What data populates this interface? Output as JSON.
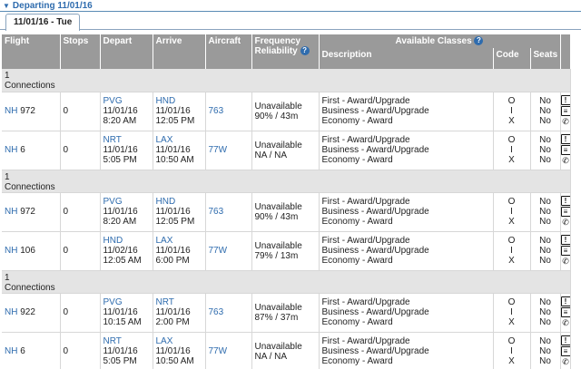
{
  "section": {
    "title": "Departing 11/01/16"
  },
  "tab": {
    "label": "11/01/16 - Tue"
  },
  "headers": {
    "flight": "Flight",
    "stops": "Stops",
    "depart": "Depart",
    "arrive": "Arrive",
    "aircraft": "Aircraft",
    "frequency": "Frequency",
    "reliability": "Reliability",
    "available_classes": "Available Classes",
    "description": "Description",
    "code": "Code",
    "seats": "Seats"
  },
  "connections_label": [
    "1",
    "Connections"
  ],
  "groups": [
    {
      "legs": [
        {
          "airline": "NH",
          "number": "972",
          "stops": "0",
          "dep_airport": "PVG",
          "dep_date": "11/01/16",
          "dep_time": "8:20 AM",
          "arr_airport": "HND",
          "arr_date": "11/01/16",
          "arr_time": "12:05 PM",
          "aircraft": "763",
          "frequency": "Unavailable",
          "reliability": "90% / 43m",
          "classes": [
            {
              "desc": "First - Award/Upgrade",
              "code": "O",
              "seats": "No"
            },
            {
              "desc": "Business - Award/Upgrade",
              "code": "I",
              "seats": "No"
            },
            {
              "desc": "Economy - Award",
              "code": "X",
              "seats": "No"
            }
          ]
        },
        {
          "airline": "NH",
          "number": "6",
          "stops": "0",
          "dep_airport": "NRT",
          "dep_date": "11/01/16",
          "dep_time": "5:05 PM",
          "arr_airport": "LAX",
          "arr_date": "11/01/16",
          "arr_time": "10:50 AM",
          "aircraft": "77W",
          "frequency": "Unavailable",
          "reliability": "NA / NA",
          "classes": [
            {
              "desc": "First - Award/Upgrade",
              "code": "O",
              "seats": "No"
            },
            {
              "desc": "Business - Award/Upgrade",
              "code": "I",
              "seats": "No"
            },
            {
              "desc": "Economy - Award",
              "code": "X",
              "seats": "No"
            }
          ]
        }
      ]
    },
    {
      "legs": [
        {
          "airline": "NH",
          "number": "972",
          "stops": "0",
          "dep_airport": "PVG",
          "dep_date": "11/01/16",
          "dep_time": "8:20 AM",
          "arr_airport": "HND",
          "arr_date": "11/01/16",
          "arr_time": "12:05 PM",
          "aircraft": "763",
          "frequency": "Unavailable",
          "reliability": "90% / 43m",
          "classes": [
            {
              "desc": "First - Award/Upgrade",
              "code": "O",
              "seats": "No"
            },
            {
              "desc": "Business - Award/Upgrade",
              "code": "I",
              "seats": "No"
            },
            {
              "desc": "Economy - Award",
              "code": "X",
              "seats": "No"
            }
          ]
        },
        {
          "airline": "NH",
          "number": "106",
          "stops": "0",
          "dep_airport": "HND",
          "dep_date": "11/02/16",
          "dep_time": "12:05 AM",
          "arr_airport": "LAX",
          "arr_date": "11/01/16",
          "arr_time": "6:00 PM",
          "aircraft": "77W",
          "frequency": "Unavailable",
          "reliability": "79% / 13m",
          "classes": [
            {
              "desc": "First - Award/Upgrade",
              "code": "O",
              "seats": "No"
            },
            {
              "desc": "Business - Award/Upgrade",
              "code": "I",
              "seats": "No"
            },
            {
              "desc": "Economy - Award",
              "code": "X",
              "seats": "No"
            }
          ]
        }
      ]
    },
    {
      "legs": [
        {
          "airline": "NH",
          "number": "922",
          "stops": "0",
          "dep_airport": "PVG",
          "dep_date": "11/01/16",
          "dep_time": "10:15 AM",
          "arr_airport": "NRT",
          "arr_date": "11/01/16",
          "arr_time": "2:00 PM",
          "aircraft": "763",
          "frequency": "Unavailable",
          "reliability": "87% / 37m",
          "classes": [
            {
              "desc": "First - Award/Upgrade",
              "code": "O",
              "seats": "No"
            },
            {
              "desc": "Business - Award/Upgrade",
              "code": "I",
              "seats": "No"
            },
            {
              "desc": "Economy - Award",
              "code": "X",
              "seats": "No"
            }
          ]
        },
        {
          "airline": "NH",
          "number": "6",
          "stops": "0",
          "dep_airport": "NRT",
          "dep_date": "11/01/16",
          "dep_time": "5:05 PM",
          "arr_airport": "LAX",
          "arr_date": "11/01/16",
          "arr_time": "10:50 AM",
          "aircraft": "77W",
          "frequency": "Unavailable",
          "reliability": "NA / NA",
          "classes": [
            {
              "desc": "First - Award/Upgrade",
              "code": "O",
              "seats": "No"
            },
            {
              "desc": "Business - Award/Upgrade",
              "code": "I",
              "seats": "No"
            },
            {
              "desc": "Economy - Award",
              "code": "X",
              "seats": "No"
            }
          ]
        }
      ]
    }
  ],
  "icons": {
    "info": "info-icon",
    "seatmap": "seatmap-icon",
    "phone": "phone-icon",
    "help": "help-icon",
    "collapse": "collapse-triangle-icon"
  }
}
